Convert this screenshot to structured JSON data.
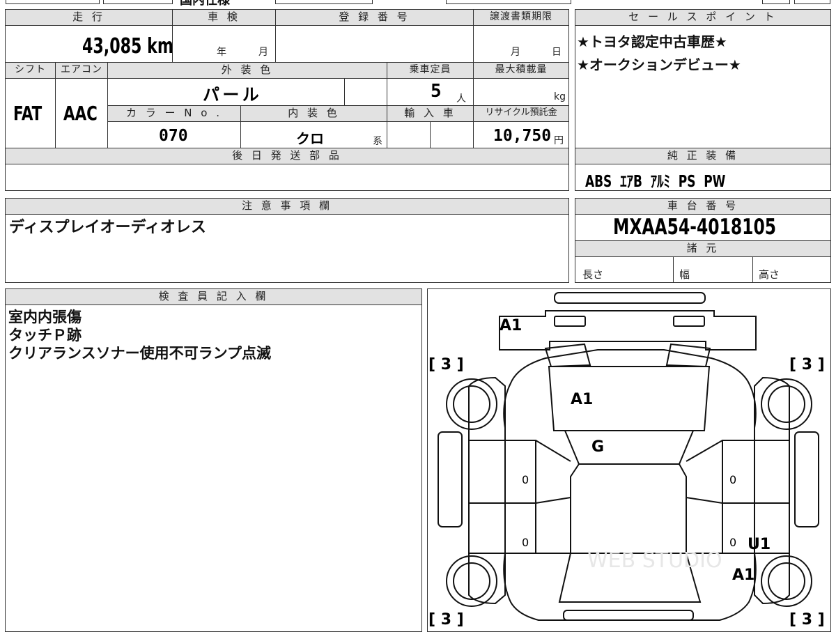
{
  "top_strip": {
    "partial": "国内仕様"
  },
  "mileage": {
    "label": "走 行",
    "value": "43,085 km"
  },
  "inspection": {
    "label": "車 検",
    "year_unit": "年",
    "month_unit": "月"
  },
  "registration": {
    "label": "登 録 番 号"
  },
  "transfer_deadline": {
    "label": "譲渡書類期限",
    "month_unit": "月",
    "day_unit": "日"
  },
  "shift": {
    "label": "シフト",
    "value": "FAT"
  },
  "aircon": {
    "label": "エアコン",
    "value": "AAC"
  },
  "exterior_color": {
    "label": "外 装 色",
    "value": "パ ー ル"
  },
  "capacity": {
    "label": "乗車定員",
    "value": "5",
    "unit": "人"
  },
  "max_load": {
    "label": "最大積載量",
    "unit": "kg"
  },
  "color_no": {
    "label": "カ ラ ー N o .",
    "value": "070"
  },
  "interior_color": {
    "label": "内 装 色",
    "value": "クロ",
    "unit": "系"
  },
  "import": {
    "label": "輸 入 車"
  },
  "recycle": {
    "label": "リサイクル預託金",
    "value": "10,750",
    "unit": "円"
  },
  "later_parts": {
    "label": "後 日 発 送 部 品"
  },
  "sales_points": {
    "label": "セ ー ル ス ポ イ ン ト",
    "lines": [
      "★トヨタ認定中古車歴★",
      "★オークションデビュー★"
    ]
  },
  "equipment": {
    "label": "純 正 装 備",
    "value": "ABS  ｴｱB  ｱﾙﾐ  PS  PW"
  },
  "caution": {
    "label": "注 意 事 項 欄",
    "text": "ディスプレイオーディオレス"
  },
  "chassis": {
    "label": "車 台 番 号",
    "value": "MXAA54-4018105"
  },
  "specs": {
    "label": "諸 元",
    "length": "長さ",
    "width": "幅",
    "height": "高さ"
  },
  "inspector": {
    "label": "検 査 員 記 入 欄",
    "lines": [
      "室内内張傷",
      "タッチＰ跡",
      "クリアランスソナー使用不可ランプ点滅"
    ]
  },
  "diagram": {
    "marks": {
      "rear_bumper": "A1",
      "hood": "A1",
      "windshield": "G",
      "rear_right_door": "U1",
      "rear_right_fender": "A1"
    },
    "tires": {
      "front_left": "[ 3 ]",
      "front_right": "[ 3 ]",
      "rear_left": "[ 3 ]",
      "rear_right": "[ 3 ]"
    },
    "door_values": {
      "fl": "0",
      "rl": "0",
      "fr": "0",
      "rr": "0"
    },
    "watermark": "WEB STUDIO"
  }
}
